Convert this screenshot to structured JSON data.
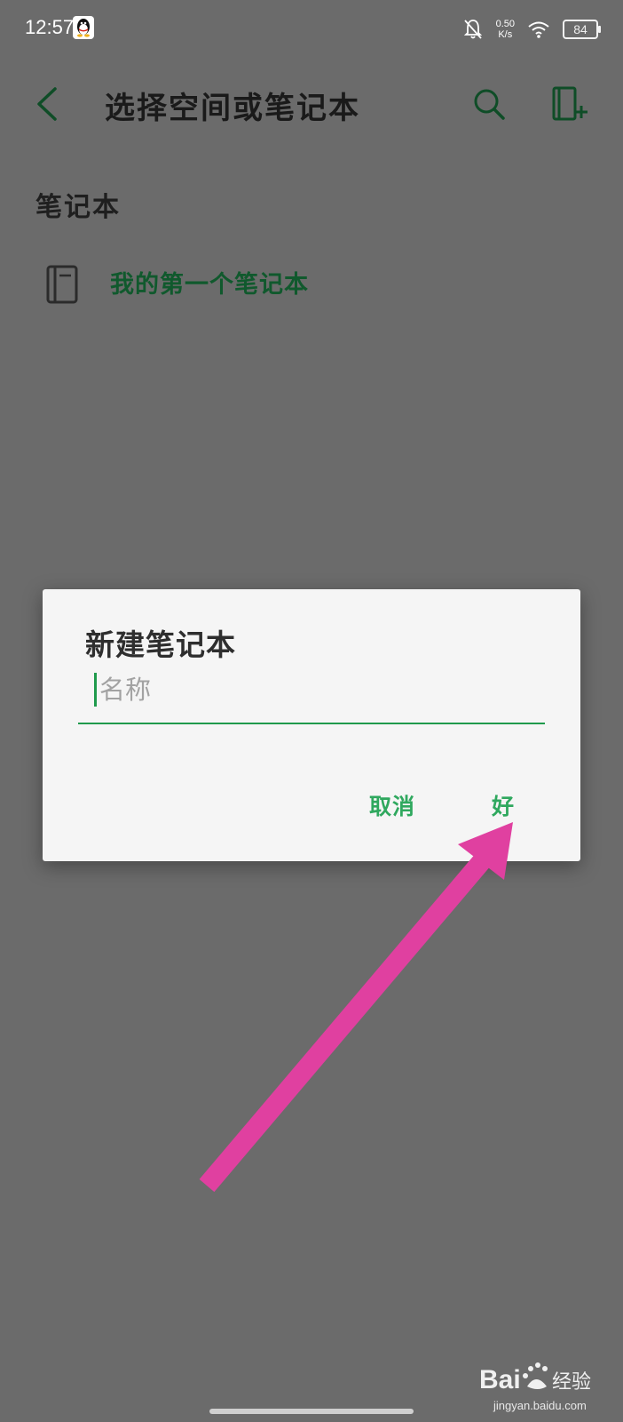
{
  "status_bar": {
    "time": "12:57",
    "net_speed_value": "0.50",
    "net_speed_unit": "K/s",
    "battery": "84"
  },
  "header": {
    "title": "选择空间或笔记本"
  },
  "section": {
    "title": "笔记本"
  },
  "notebooks": [
    {
      "label": "我的第一个笔记本"
    }
  ],
  "dialog": {
    "title": "新建笔记本",
    "name_input": {
      "placeholder": "名称",
      "value": ""
    },
    "cancel_label": "取消",
    "ok_label": "好"
  },
  "watermark": {
    "brand": "Baidu经验",
    "url": "jingyan.baidu.com"
  },
  "colors": {
    "background_dim": "#6b6b6b",
    "accent_green": "#2fa85e",
    "notebook_green": "#10592d",
    "arrow_pink": "#e040a0"
  }
}
